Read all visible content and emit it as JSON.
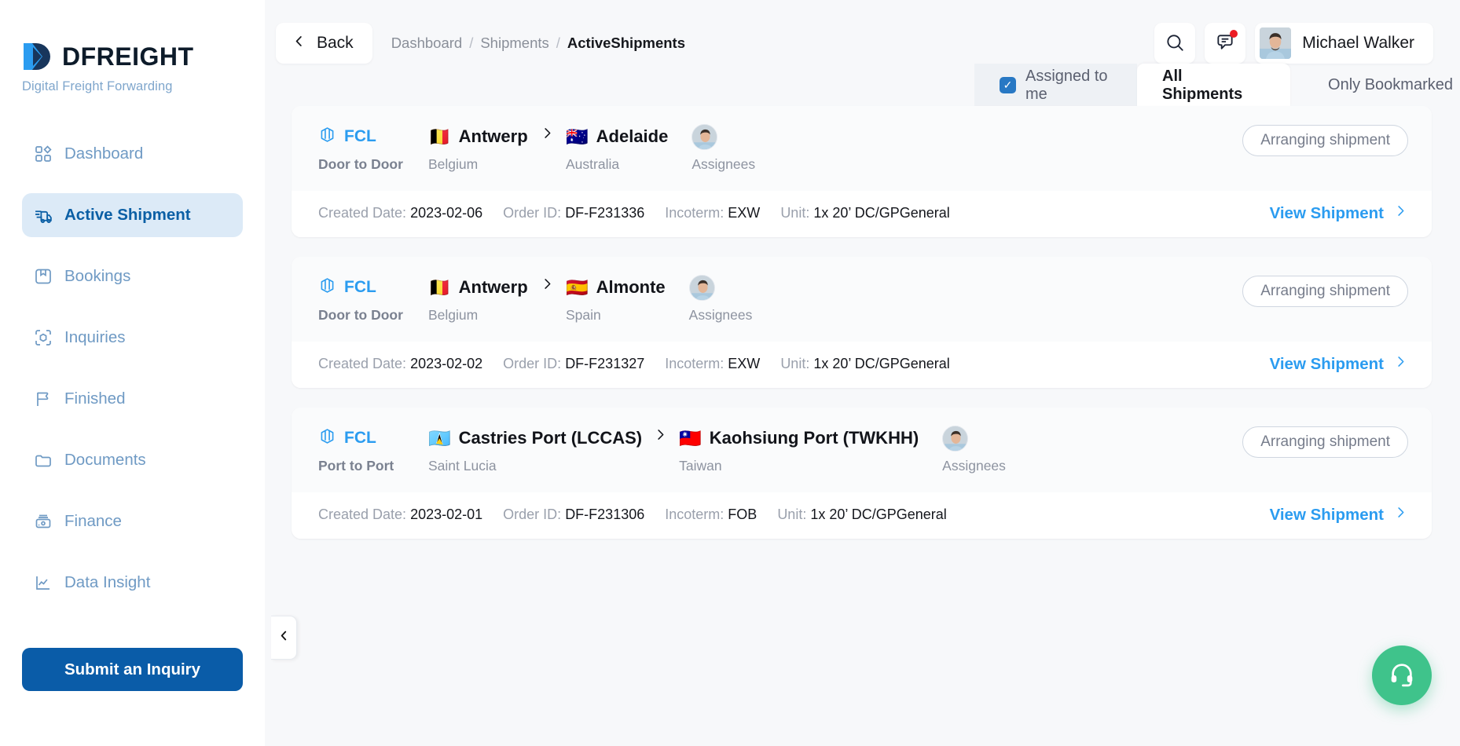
{
  "brand": {
    "name": "DFREIGHT",
    "tagline": "Digital Freight Forwarding",
    "logo_icon": "dfreight-chevron-logo",
    "accent_color": "#0a5ca8"
  },
  "sidebar": {
    "items": [
      {
        "label": "Dashboard",
        "icon": "grid-icon",
        "active": false
      },
      {
        "label": "Active Shipment",
        "icon": "truck-icon",
        "active": true
      },
      {
        "label": "Bookings",
        "icon": "bookmark-box-icon",
        "active": false
      },
      {
        "label": "Inquiries",
        "icon": "cube-scan-icon",
        "active": false
      },
      {
        "label": "Finished",
        "icon": "flag-icon",
        "active": false
      },
      {
        "label": "Documents",
        "icon": "folder-icon",
        "active": false
      },
      {
        "label": "Finance",
        "icon": "wallet-icon",
        "active": false
      }
    ],
    "data_insight": {
      "label": "Data Insight",
      "icon": "line-chart-icon"
    },
    "cta": {
      "label": "Submit an Inquiry"
    },
    "collapse_icon": "chevron-left-icon"
  },
  "topbar": {
    "back_label": "Back",
    "back_icon": "chevron-left-icon",
    "breadcrumb": [
      {
        "label": "Dashboard",
        "current": false
      },
      {
        "label": "Shipments",
        "current": false
      },
      {
        "label": "ActiveShipments",
        "current": true
      }
    ],
    "separator": "/",
    "search_icon": "search-icon",
    "messages_icon": "chat-bubble-icon",
    "messages_has_unread": true,
    "user": {
      "name": "Michael Walker",
      "avatar": "user-avatar"
    }
  },
  "filters": {
    "assigned_to_me": {
      "label": "Assigned to me",
      "checked": true
    },
    "tabs": [
      {
        "label": "All Shipments",
        "active": true
      },
      {
        "label": "Only Bookmarked",
        "active": false
      }
    ]
  },
  "labels": {
    "created_date": "Created Date:",
    "order_id": "Order ID:",
    "incoterm": "Incoterm:",
    "unit": "Unit:",
    "assignees": "Assignees",
    "view_shipment": "View Shipment",
    "view_chevron": "chevron-right-icon",
    "route_arrow": "chevron-right-icon"
  },
  "shipments": [
    {
      "mode": "FCL",
      "mode_icon": "container-cube-icon",
      "service": "Door to Door",
      "origin": {
        "city": "Antwerp",
        "country": "Belgium",
        "flag": "🇧🇪"
      },
      "destination": {
        "city": "Adelaide",
        "country": "Australia",
        "flag": "🇦🇺"
      },
      "status": "Arranging shipment",
      "created_date": "2023-02-06",
      "order_id": "DF-F231336",
      "incoterm": "EXW",
      "unit": "1x 20’ DC/GPGeneral"
    },
    {
      "mode": "FCL",
      "mode_icon": "container-cube-icon",
      "service": "Door to Door",
      "origin": {
        "city": "Antwerp",
        "country": "Belgium",
        "flag": "🇧🇪"
      },
      "destination": {
        "city": "Almonte",
        "country": "Spain",
        "flag": "🇪🇸"
      },
      "status": "Arranging shipment",
      "created_date": "2023-02-02",
      "order_id": "DF-F231327",
      "incoterm": "EXW",
      "unit": "1x 20’ DC/GPGeneral"
    },
    {
      "mode": "FCL",
      "mode_icon": "container-cube-icon",
      "service": "Port to Port",
      "origin": {
        "city": "Castries Port (LCCAS)",
        "country": "Saint Lucia",
        "flag": "🇱🇨"
      },
      "destination": {
        "city": "Kaohsiung Port (TWKHH)",
        "country": "Taiwan",
        "flag": "🇹🇼"
      },
      "status": "Arranging shipment",
      "created_date": "2023-02-01",
      "order_id": "DF-F231306",
      "incoterm": "FOB",
      "unit": "1x 20’ DC/GPGeneral"
    }
  ],
  "support": {
    "icon": "headset-icon",
    "color": "#3fc38b"
  }
}
